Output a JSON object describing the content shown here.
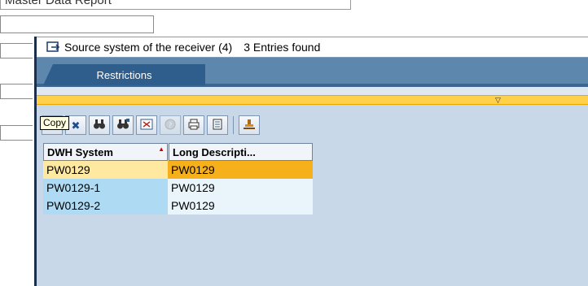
{
  "background": {
    "top_box_text": "Master Data Report"
  },
  "popup": {
    "title": "Source system of the receiver (4)",
    "entries_found": "3 Entries found",
    "tab_label": "Restrictions",
    "collapse_icon": "triangle-down-icon"
  },
  "toolbar": {
    "buttons": [
      {
        "name": "copy-button",
        "icon": "checkmark-icon",
        "glyph": "✔",
        "color": "#1c8c1c"
      },
      {
        "name": "cancel-button",
        "icon": "close-icon",
        "glyph": "✖",
        "color": "#1b4f8f"
      },
      {
        "name": "find-button",
        "icon": "binoculars-icon",
        "glyph": "🔍",
        "color": "#333333"
      },
      {
        "name": "find-next-button",
        "icon": "binoculars-plus-icon",
        "glyph": "🔎",
        "color": "#333333"
      },
      {
        "name": "new-search-button",
        "icon": "new-list-icon",
        "glyph": "⊞",
        "color": "#2e5d8c"
      },
      {
        "name": "help-button",
        "icon": "help-icon",
        "glyph": "?",
        "color": "#7a7a7a"
      },
      {
        "name": "print-button",
        "icon": "printer-icon",
        "glyph": "⎙",
        "color": "#333333"
      },
      {
        "name": "export-button",
        "icon": "list-icon",
        "glyph": "▤",
        "color": "#333333"
      },
      {
        "name": "personalize-button",
        "icon": "stamp-icon",
        "glyph": "⚒",
        "color": "#a05a00"
      }
    ]
  },
  "table": {
    "headers": [
      "DWH System",
      "Long Descripti..."
    ],
    "rows": [
      [
        "PW0129",
        "PW0129"
      ],
      [
        "PW0129-1",
        "PW0129"
      ],
      [
        "PW0129-2",
        "PW0129"
      ]
    ],
    "selected_row": 0
  },
  "tooltip": {
    "text": "Copy"
  }
}
